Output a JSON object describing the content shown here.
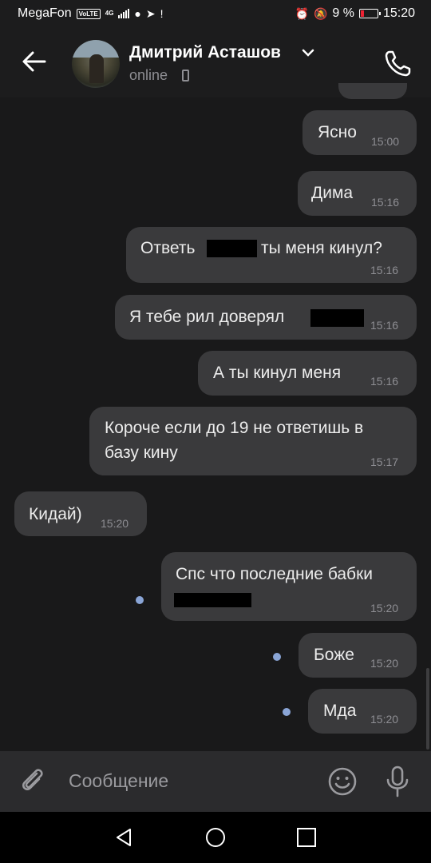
{
  "status_bar": {
    "carrier": "MegaFon",
    "volte": "VoLTE",
    "network": "4G",
    "battery_text": "9 %",
    "time": "15:20"
  },
  "header": {
    "contact_name": "Дмитрий Асташов",
    "status": "online"
  },
  "messages": [
    {
      "text": "Ясно",
      "time": "15:00",
      "side": "out"
    },
    {
      "text": "Дима",
      "time": "15:16",
      "side": "out"
    },
    {
      "text_before": "Ответь",
      "text_after": "ты меня кинул?",
      "time": "15:16",
      "side": "out",
      "redacted": true
    },
    {
      "text": "Я тебе рил доверял",
      "time": "15:16",
      "side": "out",
      "redacted": true
    },
    {
      "text": "А ты кинул меня",
      "time": "15:16",
      "side": "out"
    },
    {
      "line1": "Короче если до 19 не ответишь в",
      "line2": "базу кину",
      "time": "15:17",
      "side": "out"
    },
    {
      "text": "Кидай)",
      "time": "15:20",
      "side": "in"
    },
    {
      "text": "Спс что последние бабки",
      "time": "15:20",
      "side": "out",
      "redacted": true,
      "unread": true
    },
    {
      "text": "Боже",
      "time": "15:20",
      "side": "out",
      "unread": true
    },
    {
      "text": "Мда",
      "time": "15:20",
      "side": "out",
      "unread": true
    }
  ],
  "composer": {
    "placeholder": "Сообщение"
  },
  "colors": {
    "background": "#19191a",
    "bubble": "#3a3a3c",
    "unread_dot": "#8aa5d6",
    "timestamp": "#8e8e93"
  },
  "icons": [
    "back-arrow-icon",
    "chevron-down-icon",
    "phone-call-icon",
    "paperclip-icon",
    "emoji-icon",
    "microphone-icon",
    "nav-back-icon",
    "nav-home-icon",
    "nav-recents-icon"
  ]
}
